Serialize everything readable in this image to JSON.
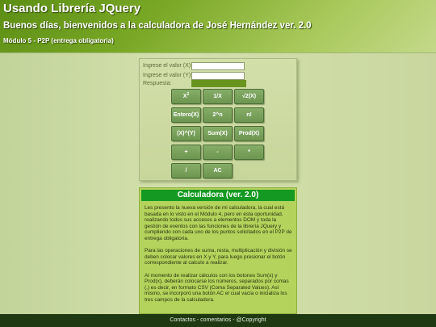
{
  "header": {
    "title": "Usando Librería JQuery",
    "greeting": "Buenos días, bienvenidos a la calculadora de José Hernández ver. 2.0",
    "module": "Módulo 5 - P2P (entrega obligatoria)"
  },
  "calculator": {
    "label_x": "Ingrese el valor (X):",
    "label_y": "Ingrese el valor (Y):",
    "label_answer": "Respuesta:",
    "value_x": "",
    "value_y": "",
    "answer": "",
    "buttons": {
      "square_base": "X",
      "square_exp": "2",
      "reciprocal": "1/X",
      "sqrt": "√2(X)",
      "integer": "Entero(X)",
      "pow2": "2^n",
      "factorial": "n!",
      "pow_xy": "(X)^(Y)",
      "sum": "Sum(X)",
      "prod": "Prod(X)",
      "add": "+",
      "subtract": "-",
      "multiply": "*",
      "divide": "/",
      "clear": "AC"
    }
  },
  "info": {
    "title": "Calculadora (ver. 2.0)",
    "paragraph1": "Les presento la nueva versión de mi calculadora, la cual está basada en lo visto en el Módulo 4, pero en ésta oportunidad, realizando todos sus accesos a elementos DOM y toda la gestión de eventos con las funciones de la librería JQuery y cumpliendo con cada uno de los puntos solicitados en el P2P de entrega obligatoria.",
    "paragraph2": "Para las operaciones de suma, resta, multiplicación y división se deben colocar valores en X y Y, para luego presionar el botón correspondiente al calculo a realizar.",
    "paragraph3": "Al momento de realizar cálculos con los botones Sum(x) y Prod(x), deberán colocarse los números, separados por comas (,) es decir, en formato CSV (Coma Separated Values). Así mismo, se incorporó una botón AC el cual vacía o inicializa los tres campos de la calculadora."
  },
  "footer": {
    "text": "Contactos - comentarios - @Copyright"
  }
}
